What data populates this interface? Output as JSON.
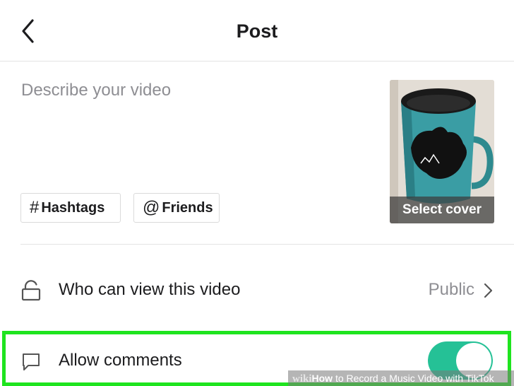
{
  "header": {
    "title": "Post",
    "back_icon": "chevron-left-icon"
  },
  "post": {
    "description_placeholder": "Describe your video",
    "description_value": "",
    "chips": [
      {
        "symbol": "#",
        "label": "Hashtags",
        "icon": "hash-icon"
      },
      {
        "symbol": "@",
        "label": "Friends",
        "icon": "at-icon"
      }
    ],
    "cover": {
      "label": "Select cover"
    }
  },
  "settings": {
    "privacy": {
      "label": "Who can view this video",
      "value": "Public",
      "icon": "unlock-icon"
    },
    "comments": {
      "label": "Allow comments",
      "icon": "comment-icon",
      "enabled": true
    }
  },
  "watermark": {
    "brand": "wiki",
    "prefix": "How",
    "text": " to Record a Music Video with TikTok"
  },
  "colors": {
    "toggle_on": "#25c196",
    "highlight": "#1fe41f",
    "secondary_text": "#8e8e93"
  }
}
